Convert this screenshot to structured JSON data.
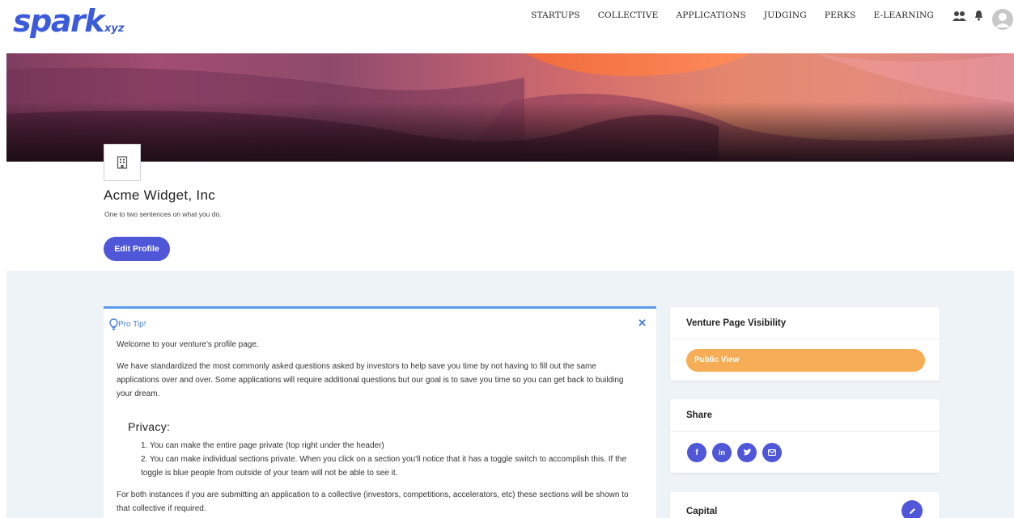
{
  "brand": {
    "name": "spark",
    "suffix": "xyz",
    "color": "#3b5bdb"
  },
  "nav": {
    "items": [
      "STARTUPS",
      "COLLECTIVE",
      "APPLICATIONS",
      "JUDGING",
      "PERKS",
      "E-LEARNING"
    ],
    "icons": [
      "people-icon",
      "bell-icon",
      "user-avatar"
    ]
  },
  "company": {
    "name": "Acme Widget, Inc",
    "tagline": "One to two sentences on what you do.",
    "edit_label": "Edit Profile"
  },
  "tip": {
    "title": "Pro Tip!",
    "welcome": "Welcome to your venture's profile page.",
    "intro": "We have standardized the most commonly asked questions asked by investors to help save you time by not having to fill out the same applications over and over. Some applications will require additional questions but our goal is to save you time so you can get back to building your dream.",
    "privacy_heading": "Privacy:",
    "privacy_items": [
      "1. You can make the entire page private (top right under the header)",
      "2. You can make individual sections private. When you click on a section you'll notice that it has a toggle switch to accomplish this. If the toggle is blue people from outside of your team will not be able to see it."
    ],
    "instances": "For both instances if you are submitting an application to a collective (investors, competitions, accelerators, etc) these sections will be shown to that collective if required."
  },
  "visibility": {
    "title": "Venture Page Visibility",
    "status": "Public View"
  },
  "share": {
    "title": "Share",
    "networks": [
      "facebook-icon",
      "linkedin-icon",
      "twitter-icon",
      "email-icon"
    ]
  },
  "capital": {
    "title": "Capital"
  },
  "colors": {
    "accent": "#4f56d8",
    "tip_border": "#5b9bea",
    "public_pill": "#f6ad55",
    "background": "#eef3f8"
  }
}
